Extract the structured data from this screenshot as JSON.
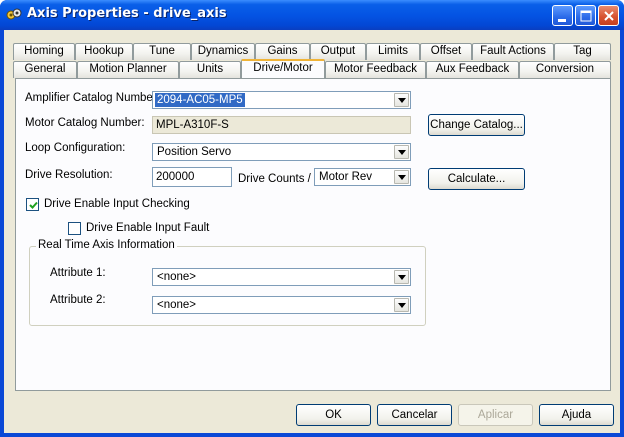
{
  "window": {
    "title": "Axis Properties - drive_axis",
    "icon": "axis-app-icon"
  },
  "tabs": {
    "row_back": [
      "Homing",
      "Hookup",
      "Tune",
      "Dynamics",
      "Gains",
      "Output",
      "Limits",
      "Offset",
      "Fault Actions",
      "Tag"
    ],
    "row_front": [
      "General",
      "Motion Planner",
      "Units",
      "Drive/Motor",
      "Motor Feedback",
      "Aux Feedback",
      "Conversion"
    ],
    "active": "Drive/Motor"
  },
  "form": {
    "amplifier_label": "Amplifier Catalog Number:",
    "amplifier_value": "2094-AC05-MP5",
    "motor_label": "Motor Catalog Number:",
    "motor_value": "MPL-A310F-S",
    "change_catalog_label": "Change Catalog...",
    "loop_label": "Loop Configuration:",
    "loop_value": "Position Servo",
    "resolution_label": "Drive Resolution:",
    "resolution_value": "200000",
    "drive_counts_label": "Drive Counts /",
    "drive_counts_unit": "Motor Rev",
    "calculate_label": "Calculate...",
    "enable_checking_label": "Drive Enable Input Checking",
    "enable_checking_checked": true,
    "enable_fault_label": "Drive Enable Input Fault",
    "enable_fault_checked": false
  },
  "realtime": {
    "legend": "Real Time Axis Information",
    "attr1_label": "Attribute 1:",
    "attr1_value": "<none>",
    "attr2_label": "Attribute 2:",
    "attr2_value": "<none>"
  },
  "footer": {
    "ok": "OK",
    "cancel": "Cancelar",
    "apply": "Aplicar",
    "help": "Ajuda"
  },
  "colors": {
    "titlebar": "#0454e4",
    "dialog_bg": "#ece9d8",
    "selection": "#316ac5",
    "active_tab_accent": "#f0b438"
  }
}
